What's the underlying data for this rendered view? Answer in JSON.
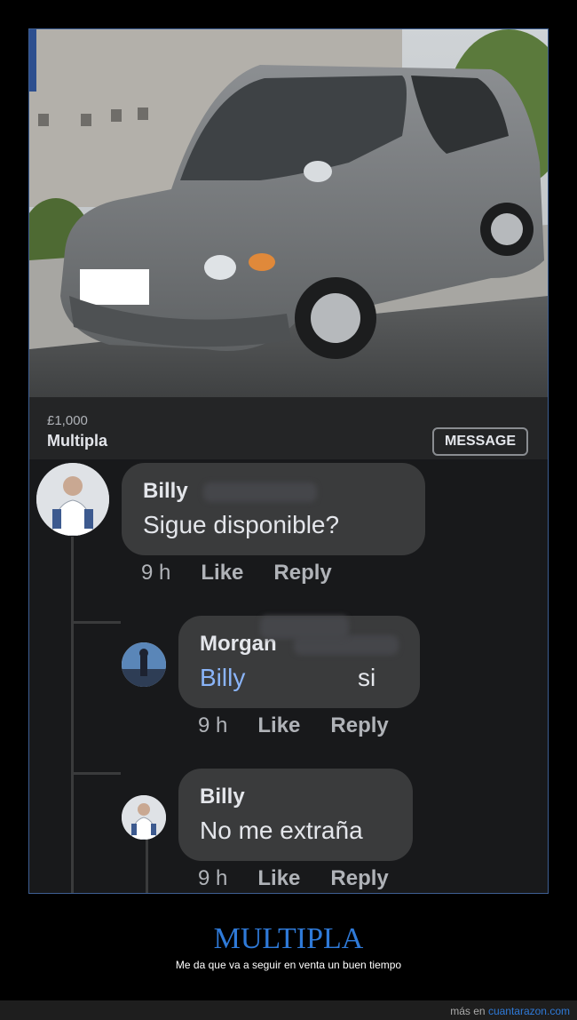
{
  "listing": {
    "price": "£1,000",
    "title": "Multipla",
    "message_button": "MESSAGE"
  },
  "comments": [
    {
      "author": "Billy",
      "text": "Sigue disponible?",
      "time": "9 h",
      "like": "Like",
      "reply": "Reply"
    },
    {
      "author": "Morgan",
      "mention": "Billy",
      "text": "si",
      "time": "9 h",
      "like": "Like",
      "reply": "Reply"
    },
    {
      "author": "Billy",
      "text": "No me extraña",
      "time": "9 h",
      "like": "Like",
      "reply": "Reply"
    }
  ],
  "caption": {
    "title": "MULTIPLA",
    "subtitle": "Me da que va a seguir en venta un buen tiempo"
  },
  "footer": {
    "prefix": "más en",
    "site": "cuantarazon.com"
  },
  "colors": {
    "accent_blue": "#2f7ad8",
    "mention_blue": "#8ab4f8",
    "bubble": "#3a3b3c",
    "background": "#18191b"
  },
  "icons": [
    "car-photo",
    "user-avatar"
  ]
}
